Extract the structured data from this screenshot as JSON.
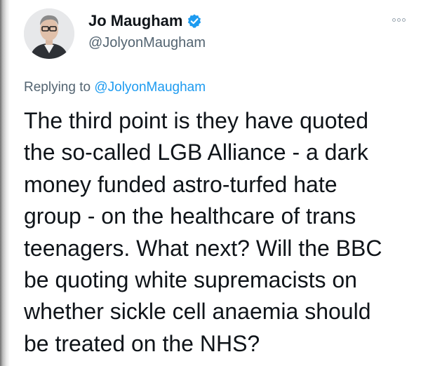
{
  "tweet": {
    "author": {
      "display_name": "Jo Maugham",
      "handle": "@JolyonMaugham",
      "verified_icon": "verified-badge-icon",
      "avatar_icon": "profile-photo"
    },
    "more_icon": "more-options-icon",
    "replying_to": {
      "prefix": "Replying to",
      "handle": "@JolyonMaugham"
    },
    "text_lines": [
      "The third point is they have quoted",
      "the so-called LGB Alliance - a dark",
      "money funded astro-turfed hate",
      "group - on the healthcare of trans",
      "teenagers. What next? Will the BBC",
      "be quoting white supremacists on",
      "whether sickle cell anaemia should",
      "be treated on the NHS?"
    ]
  },
  "colors": {
    "text_primary": "#0f1419",
    "text_secondary": "#536471",
    "accent": "#1d9bf0"
  }
}
